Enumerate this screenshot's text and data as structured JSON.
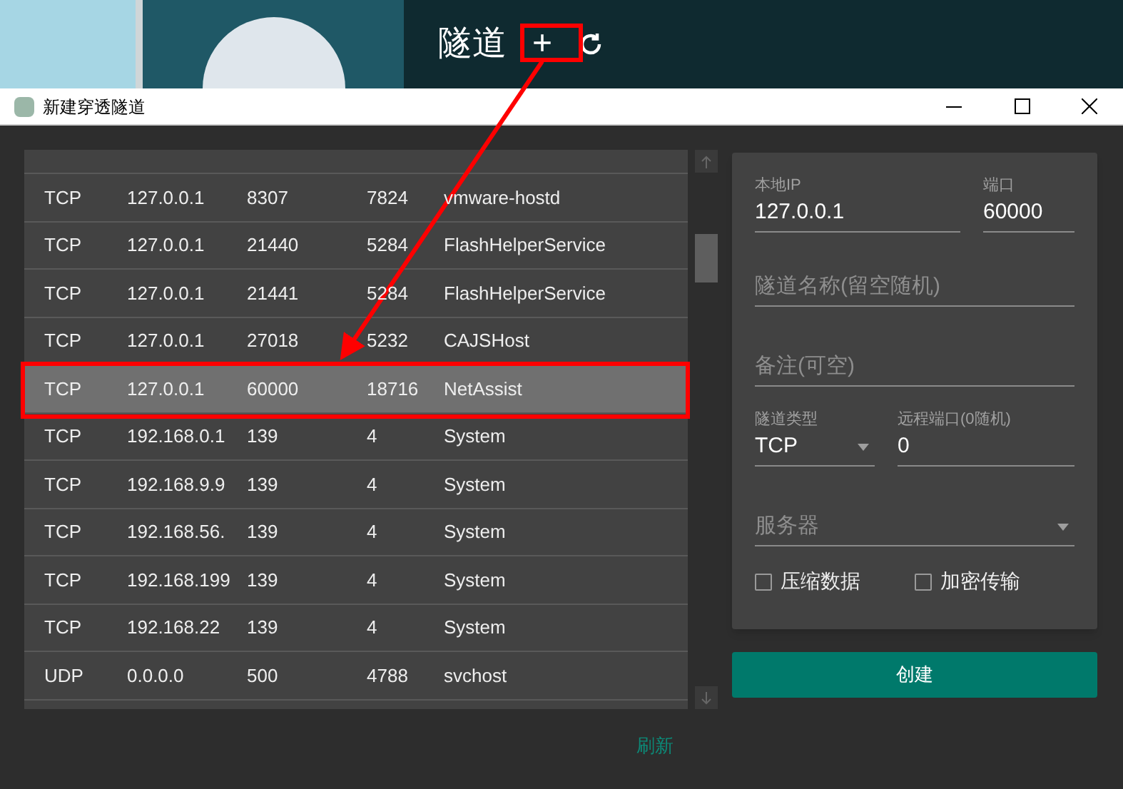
{
  "background_app": {
    "title": "隧道",
    "add_button": "+"
  },
  "window": {
    "title": "新建穿透隧道"
  },
  "table": {
    "rows": [
      {
        "protocol": "TCP",
        "address": "127.0.0.1",
        "port": "8307",
        "pid": "7824",
        "process": "vmware-hostd",
        "selected": false
      },
      {
        "protocol": "TCP",
        "address": "127.0.0.1",
        "port": "21440",
        "pid": "5284",
        "process": "FlashHelperService",
        "selected": false
      },
      {
        "protocol": "TCP",
        "address": "127.0.0.1",
        "port": "21441",
        "pid": "5284",
        "process": "FlashHelperService",
        "selected": false
      },
      {
        "protocol": "TCP",
        "address": "127.0.0.1",
        "port": "27018",
        "pid": "5232",
        "process": "CAJSHost",
        "selected": false
      },
      {
        "protocol": "TCP",
        "address": "127.0.0.1",
        "port": "60000",
        "pid": "18716",
        "process": "NetAssist",
        "selected": true
      },
      {
        "protocol": "TCP",
        "address": "192.168.0.1",
        "port": "139",
        "pid": "4",
        "process": "System",
        "selected": false
      },
      {
        "protocol": "TCP",
        "address": "192.168.9.9",
        "port": "139",
        "pid": "4",
        "process": "System",
        "selected": false
      },
      {
        "protocol": "TCP",
        "address": "192.168.56.",
        "port": "139",
        "pid": "4",
        "process": "System",
        "selected": false
      },
      {
        "protocol": "TCP",
        "address": "192.168.199",
        "port": "139",
        "pid": "4",
        "process": "System",
        "selected": false
      },
      {
        "protocol": "TCP",
        "address": "192.168.22",
        "port": "139",
        "pid": "4",
        "process": "System",
        "selected": false
      },
      {
        "protocol": "UDP",
        "address": "0.0.0.0",
        "port": "500",
        "pid": "4788",
        "process": "svchost",
        "selected": false
      }
    ]
  },
  "refresh_link": "刷新",
  "form": {
    "local_ip": {
      "label": "本地IP",
      "value": "127.0.0.1"
    },
    "port": {
      "label": "端口",
      "value": "60000"
    },
    "tunnel_name": {
      "placeholder": "隧道名称(留空随机)"
    },
    "note": {
      "placeholder": "备注(可空)"
    },
    "tunnel_type": {
      "label": "隧道类型",
      "value": "TCP"
    },
    "remote_port": {
      "label": "远程端口(0随机)",
      "value": "0"
    },
    "server": {
      "placeholder": "服务器"
    },
    "options": [
      {
        "label": "压缩数据",
        "checked": false
      },
      {
        "label": "加密传输",
        "checked": false
      }
    ],
    "create_button": "创建"
  }
}
